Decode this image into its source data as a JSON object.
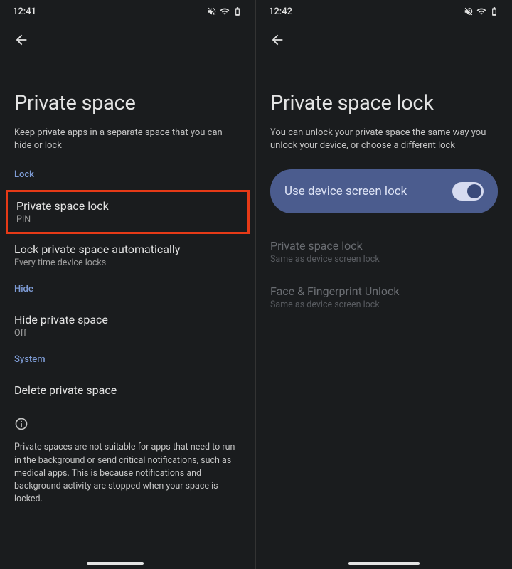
{
  "left": {
    "status_time": "12:41",
    "title": "Private space",
    "subtitle": "Keep private apps in a separate space that you can hide or lock",
    "sections": {
      "lock_header": "Lock",
      "private_space_lock": {
        "title": "Private space lock",
        "sub": "PIN"
      },
      "auto_lock": {
        "title": "Lock private space automatically",
        "sub": "Every time device locks"
      },
      "hide_header": "Hide",
      "hide_space": {
        "title": "Hide private space",
        "sub": "Off"
      },
      "system_header": "System",
      "delete_space": {
        "title": "Delete private space"
      }
    },
    "info_text": "Private spaces are not suitable for apps that need to run in the background or send critical notifications, such as medical apps. This is because notifications and background activity are stopped when your space is locked."
  },
  "right": {
    "status_time": "12:42",
    "title": "Private space lock",
    "subtitle": "You can unlock your private space the same way you unlock your device, or choose a different lock",
    "toggle_label": "Use device screen lock",
    "option1": {
      "title": "Private space lock",
      "sub": "Same as device screen lock"
    },
    "option2": {
      "title": "Face & Fingerprint Unlock",
      "sub": "Same as device screen lock"
    }
  }
}
